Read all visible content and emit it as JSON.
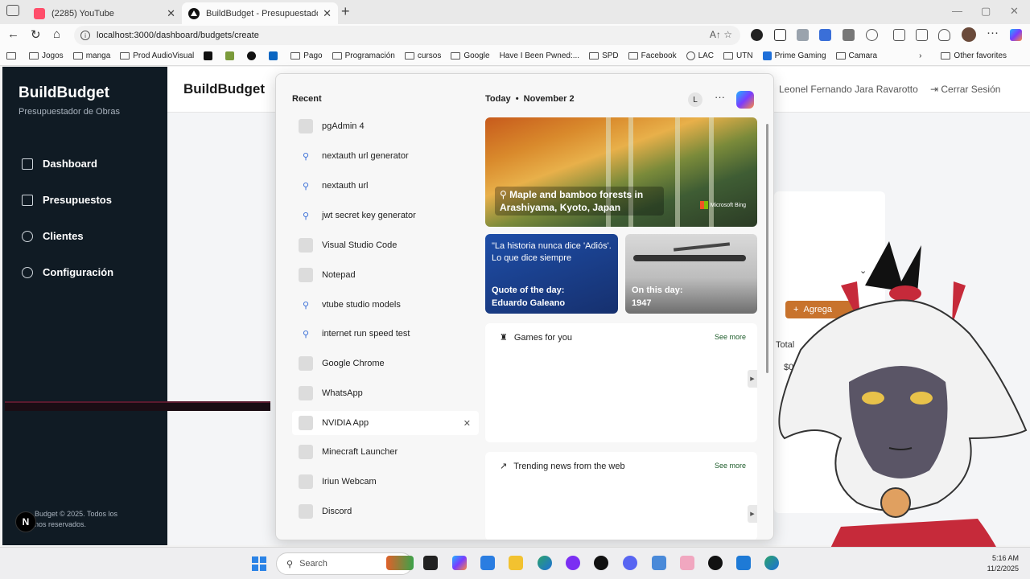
{
  "browser": {
    "tabs": [
      {
        "label": "(2285) YouTube"
      },
      {
        "label": "BuildBudget - Presupuestador de"
      }
    ],
    "url": "localhost:3000/dashboard/budgets/create",
    "bookmarks": [
      "Jogos",
      "manga",
      "Prod AudioVisual",
      "Pago",
      "Programación",
      "cursos",
      "Google",
      "Have I Been Pwned:...",
      "SPD",
      "Facebook",
      "LAC",
      "UTN",
      "Prime Gaming",
      "Camara"
    ],
    "other_favorites": "Other favorites"
  },
  "sidebar": {
    "title": "BuildBudget",
    "subtitle": "Presupuestador de Obras",
    "items": [
      {
        "label": "Dashboard"
      },
      {
        "label": "Presupuestos"
      },
      {
        "label": "Clientes"
      },
      {
        "label": "Configuración"
      }
    ],
    "footer_line1": "Budget © 2025. Todos los",
    "footer_line2": "nos reservados.",
    "n_badge": "N"
  },
  "header": {
    "title": "BuildBudget",
    "user": "Leonel Fernando Jara Ravarotto",
    "logout": "Cerrar Sesión"
  },
  "form": {
    "add_button": "Agrega",
    "total_label": "Total",
    "total_value": "$0.0"
  },
  "start_panel": {
    "recent_heading": "Recent",
    "recent": [
      {
        "label": "pgAdmin 4",
        "kind": "app"
      },
      {
        "label": "nextauth url generator",
        "kind": "search"
      },
      {
        "label": "nextauth url",
        "kind": "search"
      },
      {
        "label": "jwt secret key generator",
        "kind": "search"
      },
      {
        "label": "Visual Studio Code",
        "kind": "app"
      },
      {
        "label": "Notepad",
        "kind": "app"
      },
      {
        "label": "vtube studio models",
        "kind": "search"
      },
      {
        "label": "internet run speed test",
        "kind": "search"
      },
      {
        "label": "Google Chrome",
        "kind": "app"
      },
      {
        "label": "WhatsApp",
        "kind": "app"
      },
      {
        "label": "NVIDIA App",
        "kind": "app"
      },
      {
        "label": "Minecraft Launcher",
        "kind": "app"
      },
      {
        "label": "Iriun Webcam",
        "kind": "app"
      },
      {
        "label": "Discord",
        "kind": "app"
      }
    ],
    "today_label": "Today",
    "date": "November 2",
    "avatar_letter": "L",
    "hero_caption": "Maple and bamboo forests in Arashiyama, Kyoto, Japan",
    "hero_brand": "Microsoft Bing",
    "quote_text": "\"La historia nunca dice 'Adiós'. Lo que dice siempre",
    "quote_label": "Quote of the day:",
    "quote_author": "Eduardo Galeano",
    "otd_label": "On this day:",
    "otd_year": "1947",
    "games_title": "Games for you",
    "news_title": "Trending news from the web",
    "see_more": "See more"
  },
  "taskbar": {
    "search_placeholder": "Search",
    "time": "5:16 AM",
    "date": "11/2/2025"
  }
}
